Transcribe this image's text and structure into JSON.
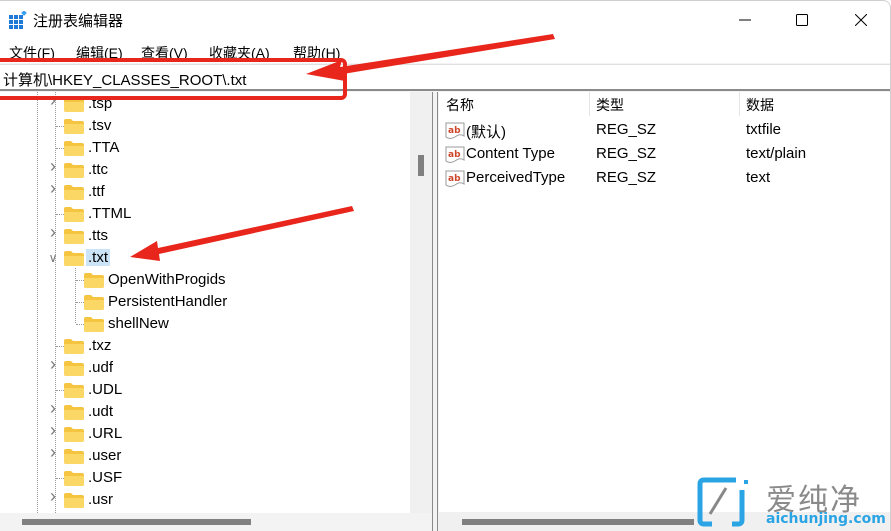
{
  "window": {
    "title": "注册表编辑器",
    "controls": {
      "minimize": "minimize",
      "maximize": "maximize",
      "close": "close"
    }
  },
  "menu": {
    "items": [
      {
        "label": "文件(F)"
      },
      {
        "label": "编辑(E)"
      },
      {
        "label": "查看(V)"
      },
      {
        "label": "收藏夹(A)"
      },
      {
        "label": "帮助(H)"
      }
    ]
  },
  "address": {
    "value": "计算机\\HKEY_CLASSES_ROOT\\.txt"
  },
  "tree": {
    "items": [
      {
        "label": ".tsp",
        "expandable": true,
        "level": 1
      },
      {
        "label": ".tsv",
        "expandable": false,
        "level": 1
      },
      {
        "label": ".TTA",
        "expandable": false,
        "level": 1
      },
      {
        "label": ".ttc",
        "expandable": true,
        "level": 1
      },
      {
        "label": ".ttf",
        "expandable": true,
        "level": 1
      },
      {
        "label": ".TTML",
        "expandable": false,
        "level": 1
      },
      {
        "label": ".tts",
        "expandable": true,
        "level": 1
      },
      {
        "label": ".txt",
        "expandable": true,
        "expanded": true,
        "selected": true,
        "level": 1
      },
      {
        "label": "OpenWithProgids",
        "expandable": false,
        "level": 2
      },
      {
        "label": "PersistentHandler",
        "expandable": false,
        "level": 2
      },
      {
        "label": "shellNew",
        "expandable": false,
        "level": 2
      },
      {
        "label": ".txz",
        "expandable": false,
        "level": 1
      },
      {
        "label": ".udf",
        "expandable": true,
        "level": 1
      },
      {
        "label": ".UDL",
        "expandable": false,
        "level": 1
      },
      {
        "label": ".udt",
        "expandable": true,
        "level": 1
      },
      {
        "label": ".URL",
        "expandable": true,
        "level": 1
      },
      {
        "label": ".user",
        "expandable": true,
        "level": 1
      },
      {
        "label": ".USF",
        "expandable": false,
        "level": 1
      },
      {
        "label": ".usr",
        "expandable": true,
        "level": 1
      }
    ]
  },
  "values": {
    "columns": [
      "名称",
      "类型",
      "数据"
    ],
    "rows": [
      {
        "name": "(默认)",
        "type": "REG_SZ",
        "data": "txtfile",
        "icon": "string-value-icon"
      },
      {
        "name": "Content Type",
        "type": "REG_SZ",
        "data": "text/plain",
        "icon": "string-value-icon"
      },
      {
        "name": "PerceivedType",
        "type": "REG_SZ",
        "data": "text",
        "icon": "string-value-icon"
      }
    ]
  },
  "watermark": {
    "cn": "爱纯净",
    "en": "aichunjing.com"
  },
  "colors": {
    "annotation": "#e8261c",
    "selection": "#cce4f7",
    "folder": "#f5c542",
    "watermark_accent": "#2aa4e4"
  }
}
